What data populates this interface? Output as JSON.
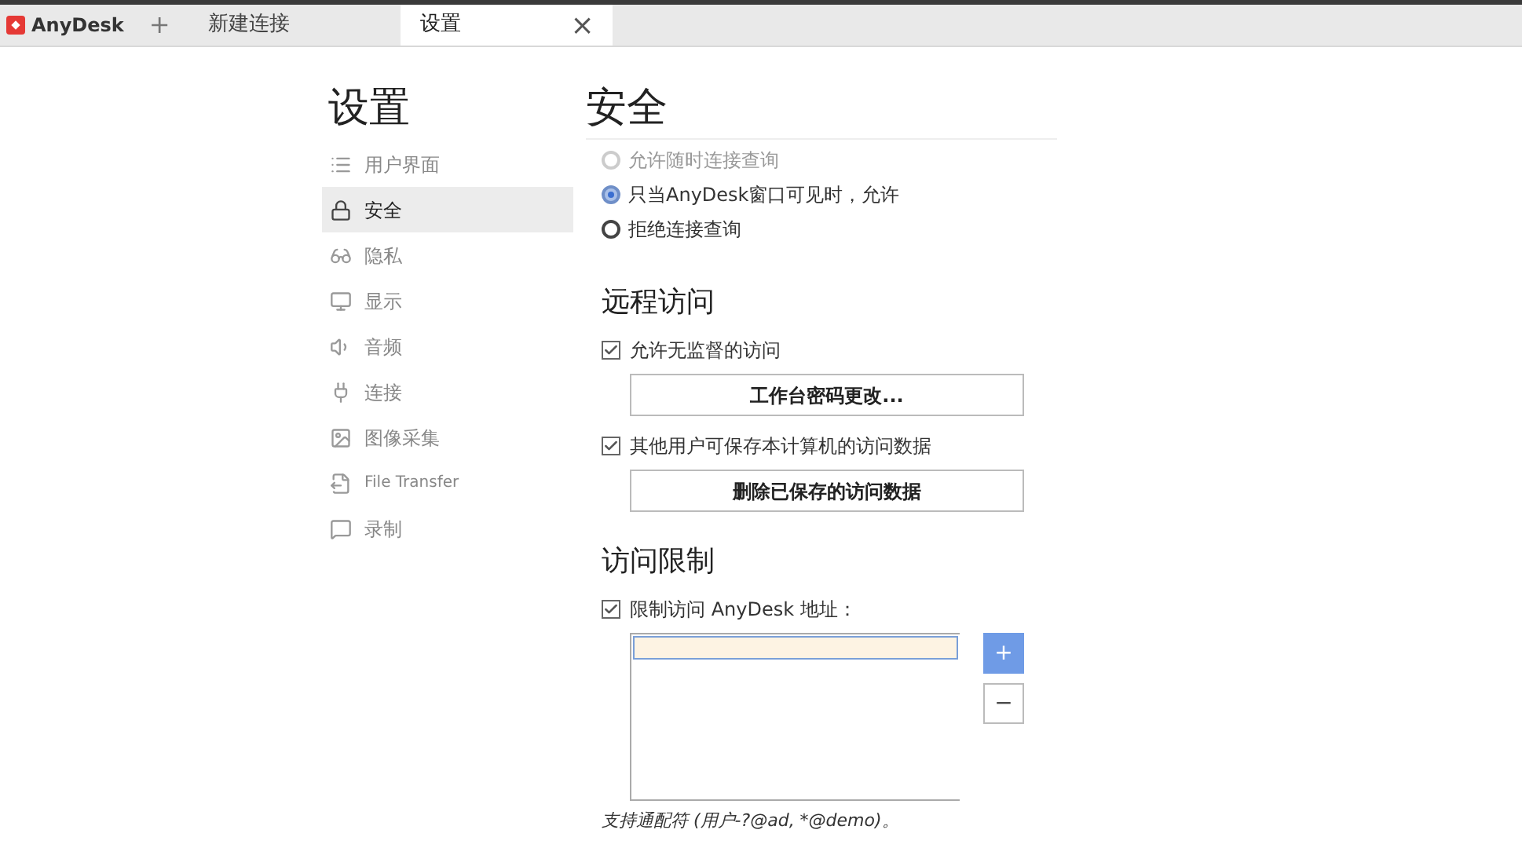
{
  "tabs": [
    {
      "kind": "app",
      "label": "AnyDesk"
    },
    {
      "kind": "add",
      "label": "+"
    },
    {
      "kind": "tab",
      "label": "新建连接",
      "selected": false
    },
    {
      "kind": "tab",
      "label": "设置",
      "selected": true,
      "close": "×"
    }
  ],
  "sidebar": {
    "title": "设置",
    "items": [
      {
        "label": "用户界面",
        "selected": false
      },
      {
        "label": "安全",
        "selected": true
      },
      {
        "label": "隐私",
        "selected": false
      },
      {
        "label": "显示",
        "selected": false
      },
      {
        "label": "音频",
        "selected": false
      },
      {
        "label": "连接",
        "selected": false
      },
      {
        "label": "图像采集",
        "selected": false
      },
      {
        "label": "File Transfer",
        "selected": false
      },
      {
        "label": "录制",
        "selected": false
      }
    ]
  },
  "main": {
    "title": "安全",
    "radios": [
      {
        "label": "允许随时连接查询",
        "selected": false,
        "disabled": true
      },
      {
        "label": "只当AnyDesk窗口可见时，允许",
        "selected": true,
        "disabled": false
      },
      {
        "label": "拒绝连接查询",
        "selected": false,
        "disabled": false
      }
    ],
    "remote_access": {
      "heading": "远程访问",
      "items": [
        {
          "kind": "checkbox",
          "label": "允许无监督的访问",
          "checked": true
        },
        {
          "kind": "button",
          "label": "工作台密码更改..."
        },
        {
          "kind": "checkbox",
          "label": "其他用户可保存本计算机的访问数据",
          "checked": true
        },
        {
          "kind": "button",
          "label": "删除已保存的访问数据"
        }
      ]
    },
    "access_limit": {
      "heading": "访问限制",
      "checkbox": {
        "label": "限制访问 AnyDesk 地址：",
        "checked": true
      },
      "add_button": "+",
      "remove_button": "−",
      "hint": "支持通配符 (用户-?@ad, *@demo)。"
    }
  }
}
